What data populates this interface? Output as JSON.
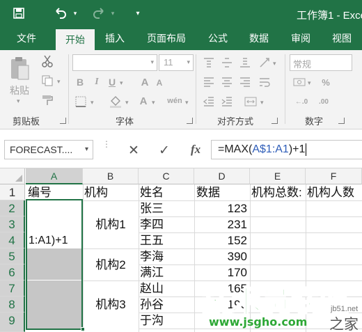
{
  "window": {
    "title": "工作簿1 - Exce"
  },
  "quick_access": {
    "save": "save-icon",
    "undo": "undo-icon",
    "redo": "redo-icon",
    "customize": "customize-icon"
  },
  "ribbon": {
    "tabs": [
      {
        "label": "文件"
      },
      {
        "label": "开始",
        "active": true
      },
      {
        "label": "插入"
      },
      {
        "label": "页面布局"
      },
      {
        "label": "公式"
      },
      {
        "label": "数据"
      },
      {
        "label": "审阅"
      },
      {
        "label": "视图"
      }
    ],
    "groups": {
      "clipboard": {
        "label": "剪贴板",
        "paste_label": "粘贴"
      },
      "font": {
        "label": "字体",
        "font_name": "",
        "font_size": "11",
        "bold": "B",
        "italic": "I",
        "underline": "U",
        "increase_size": "A",
        "decrease_size": "A"
      },
      "alignment": {
        "label": "对齐方式"
      },
      "number": {
        "label": "数字",
        "format": "常规"
      }
    }
  },
  "formula_bar": {
    "name_box": "FORECAST....",
    "formula_prefix": "=MAX(",
    "formula_ref": "A$1:A1",
    "formula_suffix": ")+1",
    "fx_label": "fx"
  },
  "sheet": {
    "columns": [
      "A",
      "B",
      "C",
      "D",
      "E",
      "F"
    ],
    "rows": [
      "1",
      "2",
      "3",
      "4",
      "5",
      "6",
      "7",
      "8",
      "9"
    ],
    "selected_column": "A",
    "headers": {
      "A": "编号",
      "B": "机构",
      "C": "姓名",
      "D": "数据",
      "E": "机构总数:",
      "F": "机构人数"
    },
    "editing_cell_text": "1:A1)+1",
    "groups": [
      {
        "name": "机构1",
        "members": [
          {
            "name": "张三",
            "value": "123"
          },
          {
            "name": "李四",
            "value": "231"
          },
          {
            "name": "王五",
            "value": "152"
          }
        ]
      },
      {
        "name": "机构2",
        "members": [
          {
            "name": "李海",
            "value": "390"
          },
          {
            "name": "满江",
            "value": "170"
          }
        ]
      },
      {
        "name": "机构3",
        "members": [
          {
            "name": "赵山",
            "value": "165"
          },
          {
            "name": "孙谷",
            "value": "190"
          },
          {
            "name": "于沟",
            "value": ""
          }
        ]
      }
    ]
  },
  "watermark": {
    "text": "技术员联盟",
    "url": "www.jsgho.com",
    "suffix": "之家",
    "small": "jb51.net"
  },
  "colors": {
    "accent": "#217346",
    "ribbon_bg": "#f3f3f3",
    "ref_blue": "#2e5db8",
    "watermark_green": "#2ea836"
  }
}
